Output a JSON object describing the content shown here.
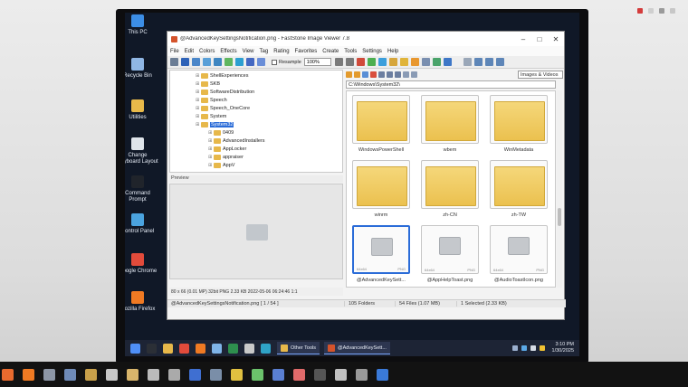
{
  "desktop": {
    "icons": [
      {
        "label": "This PC",
        "icon": "this-pc-icon",
        "color": "#3c8ee6"
      },
      {
        "label": "Recycle Bin",
        "icon": "recycle-bin-icon",
        "color": "#8fb6e4"
      },
      {
        "label": "Utilities",
        "icon": "folder-icon",
        "color": "#e8b94a"
      },
      {
        "label": "Change Keyboard Layout",
        "icon": "keyboard-icon",
        "color": "#dfe4ea"
      },
      {
        "label": "Command Prompt",
        "icon": "command-prompt-icon",
        "color": "#20242b"
      },
      {
        "label": "Control Panel",
        "icon": "control-panel-icon",
        "color": "#4aa3df"
      },
      {
        "label": "Google Chrome",
        "icon": "chrome-icon",
        "color": "#e24b3b"
      },
      {
        "label": "Mozilla Firefox",
        "icon": "firefox-icon",
        "color": "#f07a23"
      }
    ]
  },
  "window": {
    "title": "@AdvancedKeySettingsNotification.png - FastStone Image Viewer 7.8",
    "menu": [
      "File",
      "Edit",
      "Colors",
      "Effects",
      "View",
      "Tag",
      "Rating",
      "Favorites",
      "Create",
      "Tools",
      "Settings",
      "Help"
    ],
    "toolbar": {
      "resample_label": "Resample",
      "zoom_value": "100%"
    },
    "tree": [
      {
        "label": "ShellExperiences",
        "indent": 2,
        "selected": false
      },
      {
        "label": "SKB",
        "indent": 2,
        "selected": false
      },
      {
        "label": "SoftwareDistribution",
        "indent": 2,
        "selected": false
      },
      {
        "label": "Speech",
        "indent": 2,
        "selected": false
      },
      {
        "label": "Speech_OneCore",
        "indent": 2,
        "selected": false
      },
      {
        "label": "System",
        "indent": 2,
        "selected": false
      },
      {
        "label": "System32",
        "indent": 2,
        "selected": true
      },
      {
        "label": "0409",
        "indent": 3,
        "selected": false
      },
      {
        "label": "AdvancedInstallers",
        "indent": 3,
        "selected": false
      },
      {
        "label": "AppLocker",
        "indent": 3,
        "selected": false
      },
      {
        "label": "appraiser",
        "indent": 3,
        "selected": false
      },
      {
        "label": "AppV",
        "indent": 3,
        "selected": false
      }
    ],
    "preview_label": "Preview",
    "image_info": "80 x 66 (0.01 MP)   32bit   PNG   2.33 KB   2022-05-06 06:24:46   1:1",
    "sort_select": "Images & Videos",
    "path": "C:\\Windows\\System32\\",
    "thumbs": [
      {
        "caption": "WindowsPowerShell",
        "type": "folder"
      },
      {
        "caption": "wbem",
        "type": "folder"
      },
      {
        "caption": "WinMetadata",
        "type": "folder"
      },
      {
        "caption": "winrm",
        "type": "folder"
      },
      {
        "caption": "zh-CN",
        "type": "folder"
      },
      {
        "caption": "zh-TW",
        "type": "folder"
      },
      {
        "caption": "@AdvancedKeySett...",
        "type": "image",
        "format": "PNG",
        "dims": "64x64",
        "selected": true
      },
      {
        "caption": "@AppHelpToast.png",
        "type": "image",
        "format": "PNG",
        "dims": "64x64",
        "selected": false
      },
      {
        "caption": "@AudioToastIcon.png",
        "type": "image",
        "format": "PNG",
        "dims": "64x64",
        "selected": false
      }
    ],
    "status": {
      "file": "@AdvancedKeySettingsNotification.png [ 1 / 54 ]",
      "folders": "105 Folders",
      "files": "54 Files (1.07 MB)",
      "selected": "1 Selected (2.33 KB)"
    }
  },
  "taskbar": {
    "pinned": [
      {
        "icon": "start-icon",
        "color": "#4f8ff7"
      },
      {
        "icon": "terminal-icon",
        "color": "#2b2f36"
      },
      {
        "icon": "file-explorer-icon",
        "color": "#e7b84a"
      },
      {
        "icon": "chrome-icon",
        "color": "#e24b3b"
      },
      {
        "icon": "firefox-icon",
        "color": "#f07a23"
      },
      {
        "icon": "notepad-icon",
        "color": "#7fb4e8"
      },
      {
        "icon": "excel-icon",
        "color": "#2e8f4e"
      },
      {
        "icon": "faststone-icon",
        "color": "#c9c9c9"
      },
      {
        "icon": "edge-icon",
        "color": "#2fa3c7"
      }
    ],
    "tasks": [
      {
        "label": "Other Tools",
        "icon": "folder-icon",
        "color": "#e7b84a"
      },
      {
        "label": "@AdvancedKeySett...",
        "icon": "faststone-icon",
        "color": "#d4532b"
      }
    ],
    "clock_time": "3:10 PM",
    "clock_date": "1/30/2025"
  },
  "host_taskbar": {
    "icons": [
      {
        "icon": "host-start-icon",
        "color": "#e86a2e"
      },
      {
        "icon": "host-firefox-icon",
        "color": "#f07a23"
      },
      {
        "icon": "host-tool-icon",
        "color": "#8c96a6"
      },
      {
        "icon": "host-tool-icon",
        "color": "#6f8bb8"
      },
      {
        "icon": "host-tool-icon",
        "color": "#c8a04a"
      },
      {
        "icon": "host-tool-icon",
        "color": "#c8c8c8"
      },
      {
        "icon": "host-tool-icon",
        "color": "#d9b56b"
      },
      {
        "icon": "host-tool-icon",
        "color": "#bbbbbb"
      },
      {
        "icon": "host-tool-icon",
        "color": "#aaaaaa"
      },
      {
        "icon": "host-tool-icon",
        "color": "#3f6fd1"
      },
      {
        "icon": "host-tool-icon",
        "color": "#7a8ea8"
      },
      {
        "icon": "host-tool-icon",
        "color": "#e0c040"
      },
      {
        "icon": "host-tool-icon",
        "color": "#6bc26b"
      },
      {
        "icon": "host-tool-icon",
        "color": "#5a7fd1"
      },
      {
        "icon": "host-tool-icon",
        "color": "#e06a6a"
      },
      {
        "icon": "host-tool-icon",
        "color": "#555555"
      },
      {
        "icon": "host-tool-icon",
        "color": "#c0c0c0"
      },
      {
        "icon": "host-tool-icon",
        "color": "#9a9a9a"
      },
      {
        "icon": "host-tool-icon",
        "color": "#3a7ad9"
      }
    ]
  }
}
